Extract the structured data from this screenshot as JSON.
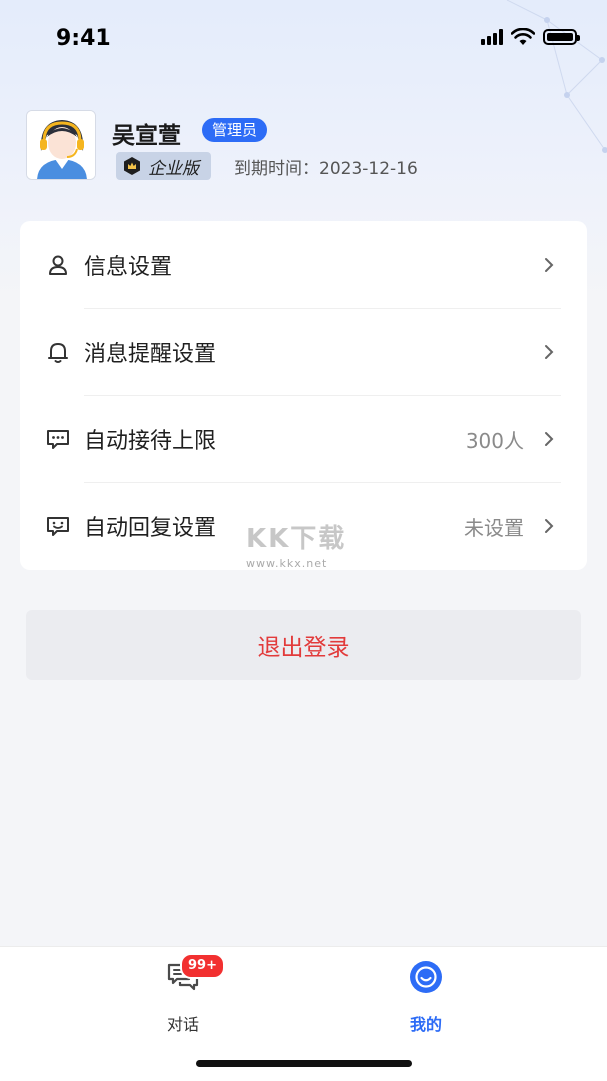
{
  "status_bar": {
    "time": "9:41"
  },
  "profile": {
    "name": "吴宣萱",
    "role_badge": "管理员",
    "edition": "企业版",
    "expiry": "到期时间：2023-12-16"
  },
  "menu": {
    "items": [
      {
        "label": "信息设置",
        "value": "",
        "icon": "user-icon"
      },
      {
        "label": "消息提醒设置",
        "value": "",
        "icon": "bell-icon"
      },
      {
        "label": "自动接待上限",
        "value": "300人",
        "icon": "chat-dots-icon"
      },
      {
        "label": "自动回复设置",
        "value": "未设置",
        "icon": "chat-smile-icon"
      }
    ]
  },
  "watermark": {
    "text": "KK下载",
    "url": "www.kkx.net"
  },
  "logout_label": "退出登录",
  "tab_bar": {
    "tabs": [
      {
        "label": "对话",
        "badge": "99+",
        "icon": "chat-bubbles-icon",
        "active": false
      },
      {
        "label": "我的",
        "icon": "profile-face-icon",
        "active": true
      }
    ]
  },
  "colors": {
    "accent": "#2d6cf6",
    "danger": "#e23b3b",
    "badge_red": "#f23030",
    "background": "#f4f5f8"
  }
}
